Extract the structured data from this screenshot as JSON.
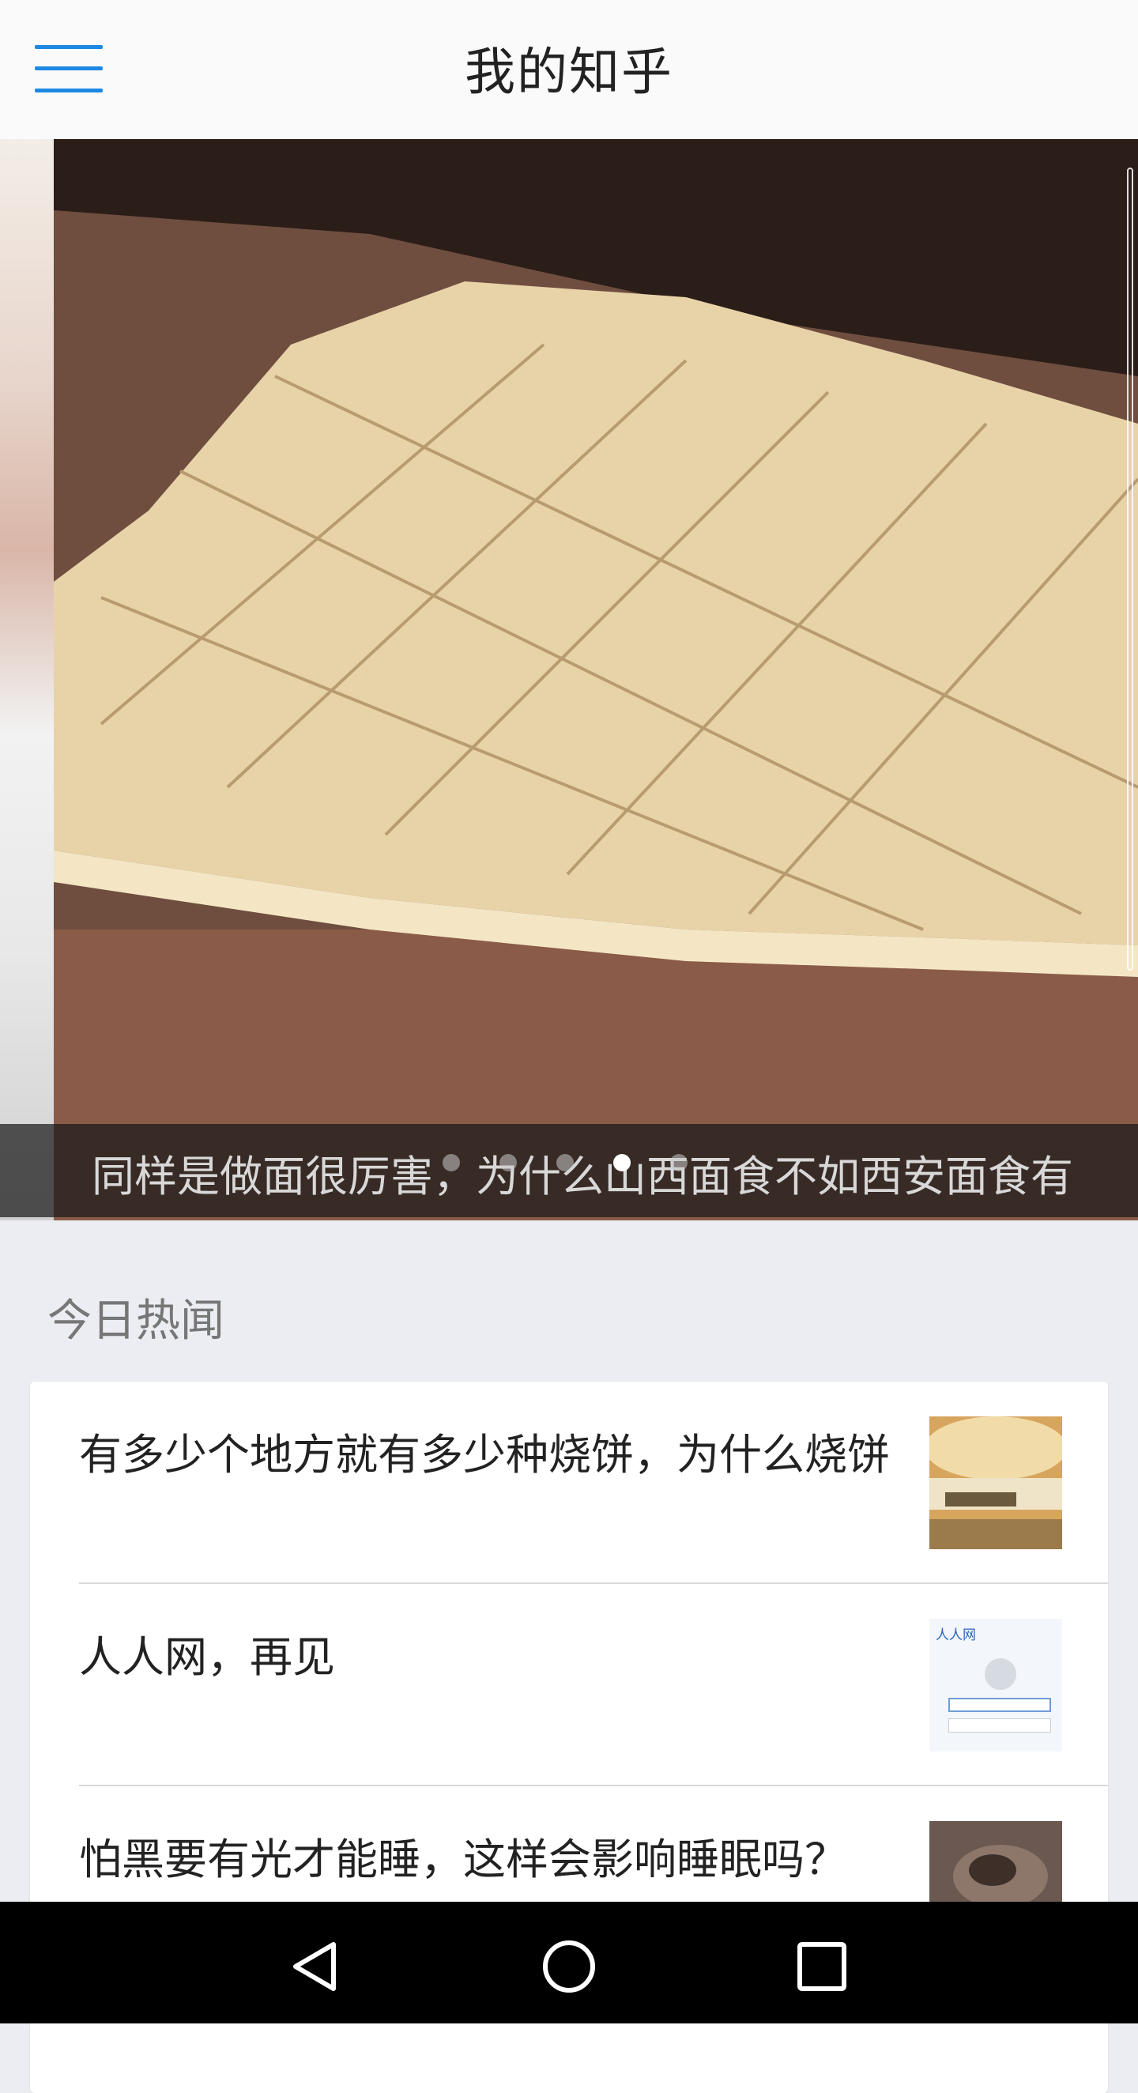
{
  "app_bar": {
    "title": "我的知乎",
    "menu_icon": "hamburger-menu-icon",
    "accent_color": "#1e88e5"
  },
  "banner": {
    "caption": "同样是做面很厉害，为什么山西面食不如西安面食有",
    "slide_count": 5,
    "active_slide_index": 3
  },
  "section": {
    "title": "今日热闻"
  },
  "news": [
    {
      "title": "有多少个地方就有多少种烧饼，为什么烧饼",
      "thumb": "shaobing-photo"
    },
    {
      "title": "人人网，再见",
      "thumb": "renren-login-screenshot",
      "thumb_logo_text": "人人网"
    },
    {
      "title": "怕黑要有光才能睡，这样会影响睡眠吗？",
      "thumb": "sleeping-person-photo"
    }
  ],
  "system_nav": {
    "back_icon": "back-triangle-icon",
    "home_icon": "home-circle-icon",
    "recents_icon": "recents-square-icon"
  }
}
